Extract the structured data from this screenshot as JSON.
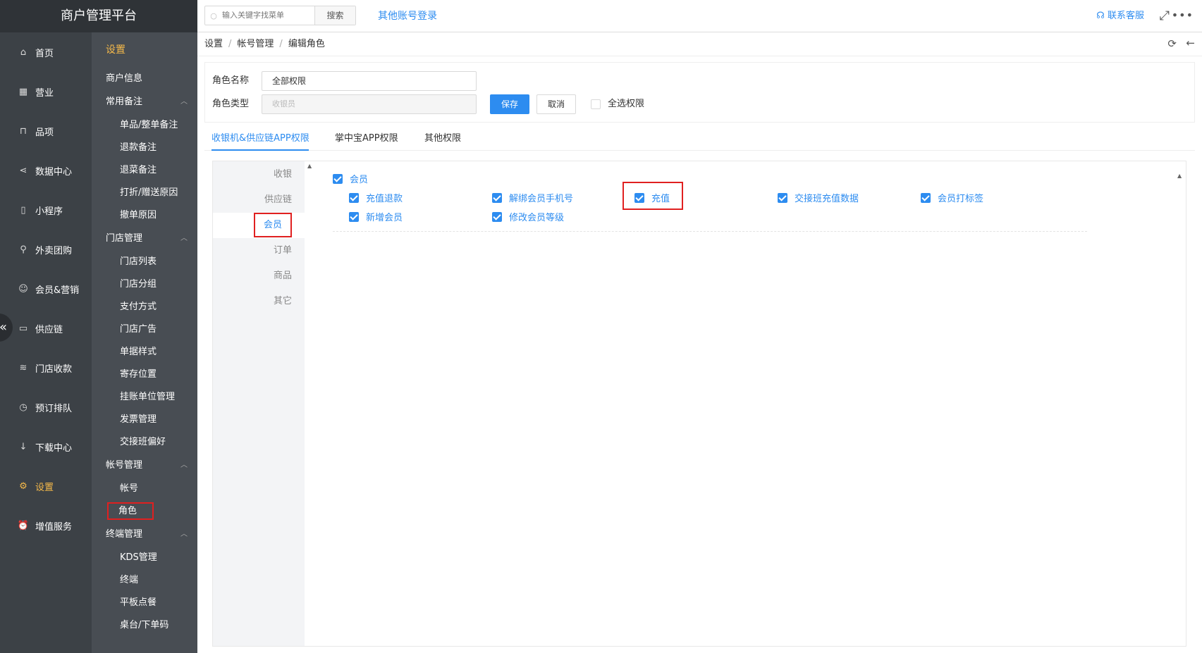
{
  "brand": "商户管理平台",
  "nav": [
    {
      "label": "首页",
      "icon": "home-icon",
      "glyph": "⌂"
    },
    {
      "label": "营业",
      "icon": "calendar-icon",
      "glyph": "▦"
    },
    {
      "label": "品项",
      "icon": "bag-icon",
      "glyph": "⊓"
    },
    {
      "label": "数据中心",
      "icon": "share-icon",
      "glyph": "⋖"
    },
    {
      "label": "小程序",
      "icon": "mobile-icon",
      "glyph": "▯"
    },
    {
      "label": "外卖团购",
      "icon": "bike-icon",
      "glyph": "⚲"
    },
    {
      "label": "会员&营销",
      "icon": "user-icon",
      "glyph": "☺"
    },
    {
      "label": "供应链",
      "icon": "truck-icon",
      "glyph": "▭"
    },
    {
      "label": "门店收款",
      "icon": "database-icon",
      "glyph": "≋"
    },
    {
      "label": "预订排队",
      "icon": "clock-icon",
      "glyph": "◷"
    },
    {
      "label": "下载中心",
      "icon": "download-icon",
      "glyph": "↓"
    },
    {
      "label": "设置",
      "icon": "gear-icon",
      "glyph": "⚙"
    },
    {
      "label": "增值服务",
      "icon": "alarm-icon",
      "glyph": "⏰"
    }
  ],
  "subnav": {
    "title": "设置",
    "shop_info": "商户信息",
    "group1": {
      "label": "常用备注",
      "children": [
        "单品/整单备注",
        "退款备注",
        "退菜备注",
        "打折/赠送原因",
        "撤单原因"
      ]
    },
    "group2": {
      "label": "门店管理",
      "children": [
        "门店列表",
        "门店分组",
        "支付方式",
        "门店广告",
        "单据样式",
        "寄存位置",
        "挂账单位管理",
        "发票管理",
        "交接班偏好"
      ]
    },
    "group3": {
      "label": "帐号管理",
      "children": [
        "帐号",
        "角色"
      ]
    },
    "group4": {
      "label": "终端管理",
      "children": [
        "KDS管理",
        "终端",
        "平板点餐",
        "桌台/下单码"
      ]
    }
  },
  "topbar": {
    "search_placeholder": "输入关键字找菜单",
    "search_btn": "搜索",
    "other_login": "其他账号登录",
    "service": "联系客服"
  },
  "breadcrumb": [
    "设置",
    "帐号管理",
    "编辑角色"
  ],
  "form": {
    "name_label": "角色名称",
    "name_value": "全部权限",
    "type_label": "角色类型",
    "type_placeholder": "收银员",
    "save": "保存",
    "cancel": "取消",
    "select_all": "全选权限"
  },
  "tabs": [
    "收银机&供应链APP权限",
    "掌中宝APP权限",
    "其他权限"
  ],
  "categories": [
    "收银",
    "供应链",
    "会员",
    "订单",
    "商品",
    "其它"
  ],
  "permissions": {
    "group": "会员",
    "row1": [
      "充值退款",
      "解绑会员手机号",
      "充值",
      "交接班充值数据",
      "会员打标签"
    ],
    "row2": [
      "新增会员",
      "修改会员等级"
    ]
  },
  "colors": {
    "accent": "#2d8cf0",
    "highlight": "#e02020",
    "nav_active": "#f5b94a"
  }
}
